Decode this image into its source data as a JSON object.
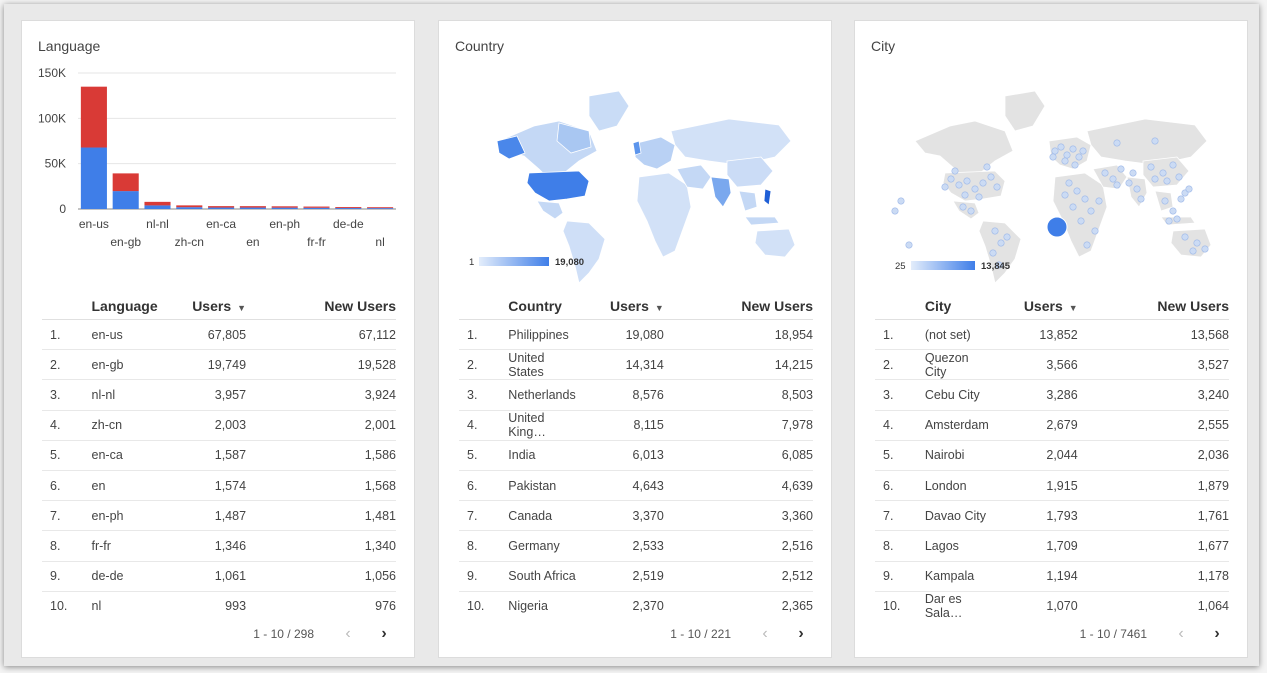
{
  "cards": {
    "language": {
      "title": "Language",
      "headers": {
        "dim": "Language",
        "users": "Users",
        "new_users": "New Users"
      },
      "sort_icon": "sort-desc-icon",
      "rows": [
        {
          "n": "1.",
          "name": "en-us",
          "users": "67,805",
          "new_users": "67,112"
        },
        {
          "n": "2.",
          "name": "en-gb",
          "users": "19,749",
          "new_users": "19,528"
        },
        {
          "n": "3.",
          "name": "nl-nl",
          "users": "3,957",
          "new_users": "3,924"
        },
        {
          "n": "4.",
          "name": "zh-cn",
          "users": "2,003",
          "new_users": "2,001"
        },
        {
          "n": "5.",
          "name": "en-ca",
          "users": "1,587",
          "new_users": "1,586"
        },
        {
          "n": "6.",
          "name": "en",
          "users": "1,574",
          "new_users": "1,568"
        },
        {
          "n": "7.",
          "name": "en-ph",
          "users": "1,487",
          "new_users": "1,481"
        },
        {
          "n": "8.",
          "name": "fr-fr",
          "users": "1,346",
          "new_users": "1,340"
        },
        {
          "n": "9.",
          "name": "de-de",
          "users": "1,061",
          "new_users": "1,056"
        },
        {
          "n": "10.",
          "name": "nl",
          "users": "993",
          "new_users": "976"
        }
      ],
      "pager": "1 - 10 / 298"
    },
    "country": {
      "title": "Country",
      "headers": {
        "dim": "Country",
        "users": "Users",
        "new_users": "New Users"
      },
      "rows": [
        {
          "n": "1.",
          "name": "Philippines",
          "users": "19,080",
          "new_users": "18,954"
        },
        {
          "n": "2.",
          "name": "United States",
          "users": "14,314",
          "new_users": "14,215"
        },
        {
          "n": "3.",
          "name": "Netherlands",
          "users": "8,576",
          "new_users": "8,503"
        },
        {
          "n": "4.",
          "name": "United King…",
          "users": "8,115",
          "new_users": "7,978"
        },
        {
          "n": "5.",
          "name": "India",
          "users": "6,013",
          "new_users": "6,085"
        },
        {
          "n": "6.",
          "name": "Pakistan",
          "users": "4,643",
          "new_users": "4,639"
        },
        {
          "n": "7.",
          "name": "Canada",
          "users": "3,370",
          "new_users": "3,360"
        },
        {
          "n": "8.",
          "name": "Germany",
          "users": "2,533",
          "new_users": "2,516"
        },
        {
          "n": "9.",
          "name": "South Africa",
          "users": "2,519",
          "new_users": "2,512"
        },
        {
          "n": "10.",
          "name": "Nigeria",
          "users": "2,370",
          "new_users": "2,365"
        }
      ],
      "legend": {
        "min": "1",
        "max": "19,080"
      },
      "pager": "1 - 10 / 221"
    },
    "city": {
      "title": "City",
      "headers": {
        "dim": "City",
        "users": "Users",
        "new_users": "New Users"
      },
      "rows": [
        {
          "n": "1.",
          "name": "(not set)",
          "users": "13,852",
          "new_users": "13,568"
        },
        {
          "n": "2.",
          "name": "Quezon City",
          "users": "3,566",
          "new_users": "3,527"
        },
        {
          "n": "3.",
          "name": "Cebu City",
          "users": "3,286",
          "new_users": "3,240"
        },
        {
          "n": "4.",
          "name": "Amsterdam",
          "users": "2,679",
          "new_users": "2,555"
        },
        {
          "n": "5.",
          "name": "Nairobi",
          "users": "2,044",
          "new_users": "2,036"
        },
        {
          "n": "6.",
          "name": "London",
          "users": "1,915",
          "new_users": "1,879"
        },
        {
          "n": "7.",
          "name": "Davao City",
          "users": "1,793",
          "new_users": "1,761"
        },
        {
          "n": "8.",
          "name": "Lagos",
          "users": "1,709",
          "new_users": "1,677"
        },
        {
          "n": "9.",
          "name": "Kampala",
          "users": "1,194",
          "new_users": "1,178"
        },
        {
          "n": "10.",
          "name": "Dar es Sala…",
          "users": "1,070",
          "new_users": "1,064"
        }
      ],
      "legend": {
        "min": "25",
        "max": "13,845"
      },
      "pager": "1 - 10 / 7461"
    }
  },
  "colors": {
    "blue": "#3f7ee8",
    "red": "#d93a36",
    "light_blue": "#d2e1f7",
    "map_gray": "#e3e3e3"
  },
  "icons": {
    "prev": "chevron-left-icon",
    "next": "chevron-right-icon"
  },
  "chart_data": {
    "type": "bar",
    "stacked": true,
    "categories": [
      "en-us",
      "en-gb",
      "nl-nl",
      "zh-cn",
      "en-ca",
      "en",
      "en-ph",
      "fr-fr",
      "de-de",
      "nl"
    ],
    "series": [
      {
        "values": [
          67805,
          19749,
          3957,
          2003,
          1587,
          1574,
          1487,
          1346,
          1061,
          993
        ]
      },
      {
        "values": [
          67112,
          19528,
          3924,
          2001,
          1586,
          1568,
          1481,
          1340,
          1056,
          976
        ]
      }
    ],
    "series_colors": [
      "#3f7ee8",
      "#d93a36"
    ],
    "ylim": [
      0,
      150000
    ],
    "yticks": [
      0,
      50000,
      100000,
      150000
    ],
    "ytick_labels": [
      "0",
      "50K",
      "100K",
      "150K"
    ],
    "grid": true
  }
}
